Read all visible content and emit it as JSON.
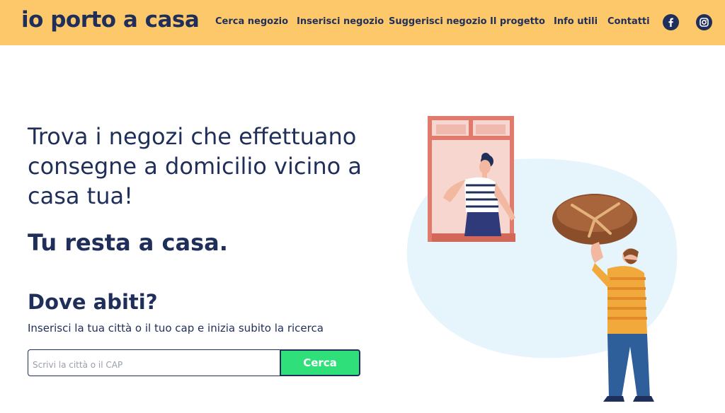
{
  "header": {
    "logo": "io porto a casa",
    "nav": [
      {
        "label": "Cerca negozio"
      },
      {
        "label": "Inserisci negozio"
      },
      {
        "label": "Suggerisci negozio"
      },
      {
        "label": "Il progetto"
      },
      {
        "label": "Info utili"
      },
      {
        "label": "Contatti"
      }
    ],
    "social": [
      {
        "icon": "facebook-icon"
      },
      {
        "icon": "instagram-icon"
      }
    ]
  },
  "hero": {
    "headline": "Trova i negozi che effettuano consegne a domicilio vicino a casa tua!",
    "tagline": "Tu resta a casa."
  },
  "search": {
    "title": "Dove abiti?",
    "subtitle": "Inserisci la tua città o il tuo cap e inizia subito la ricerca",
    "placeholder": "Scrivi la città o il CAP",
    "value": "",
    "button_label": "Cerca"
  },
  "colors": {
    "header_bg": "#fdc86a",
    "text": "#1f2f5a",
    "button_bg": "#2fe07a",
    "blob": "#e6f4fc",
    "window_frame": "#e07a6c"
  }
}
